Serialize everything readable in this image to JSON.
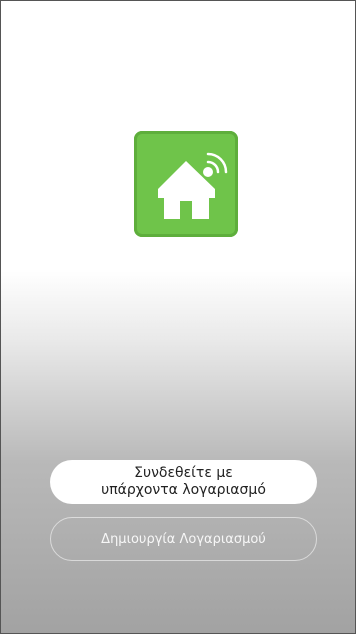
{
  "logo": {
    "icon": "smart-home-icon",
    "background_color": "#6fc44a",
    "foreground_color": "#ffffff"
  },
  "buttons": {
    "login_label": "Συνδεθείτε με\nυπάρχοντα λογαριασμό",
    "create_account_label": "Δημιουργία Λογαριασμού"
  }
}
